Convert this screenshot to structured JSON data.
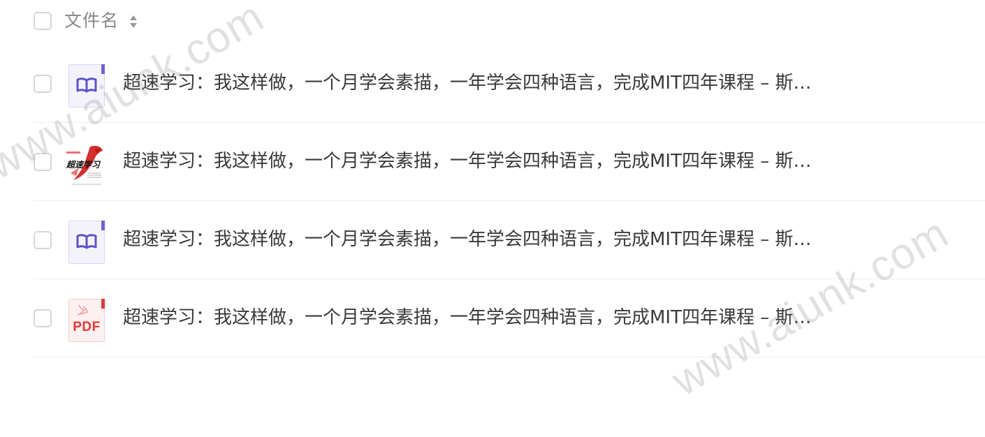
{
  "header": {
    "select_all_label": "",
    "column_title": "文件名",
    "sort_icon": "sort-updown-icon"
  },
  "files": [
    {
      "name": "超速学习：我这样做，一个月学会素描，一年学会四种语言，完成MIT四年课程 – 斯…",
      "icon": "book-icon",
      "icon_color": "#6b63d9"
    },
    {
      "name": "超速学习：我这样做，一个月学会素描，一年学会四种语言，完成MIT四年课程 – 斯…",
      "icon": "book-cover-thumbnail",
      "cover_title": "超速学习",
      "icon_color": "#d32f2f"
    },
    {
      "name": "超速学习：我这样做，一个月学会素描，一年学会四种语言，完成MIT四年课程 – 斯…",
      "icon": "book-icon",
      "icon_color": "#6b63d9"
    },
    {
      "name": "超速学习：我这样做，一个月学会素描，一年学会四种语言，完成MIT四年课程 – 斯…",
      "icon": "pdf-icon",
      "icon_label": "PDF",
      "icon_color": "#e53935"
    }
  ],
  "watermark": "www.aiunk.com",
  "colors": {
    "text": "#3a3a3a",
    "header_text": "#8a8a8a",
    "divider": "#ededed",
    "checkbox_border": "#d6d6d6"
  }
}
